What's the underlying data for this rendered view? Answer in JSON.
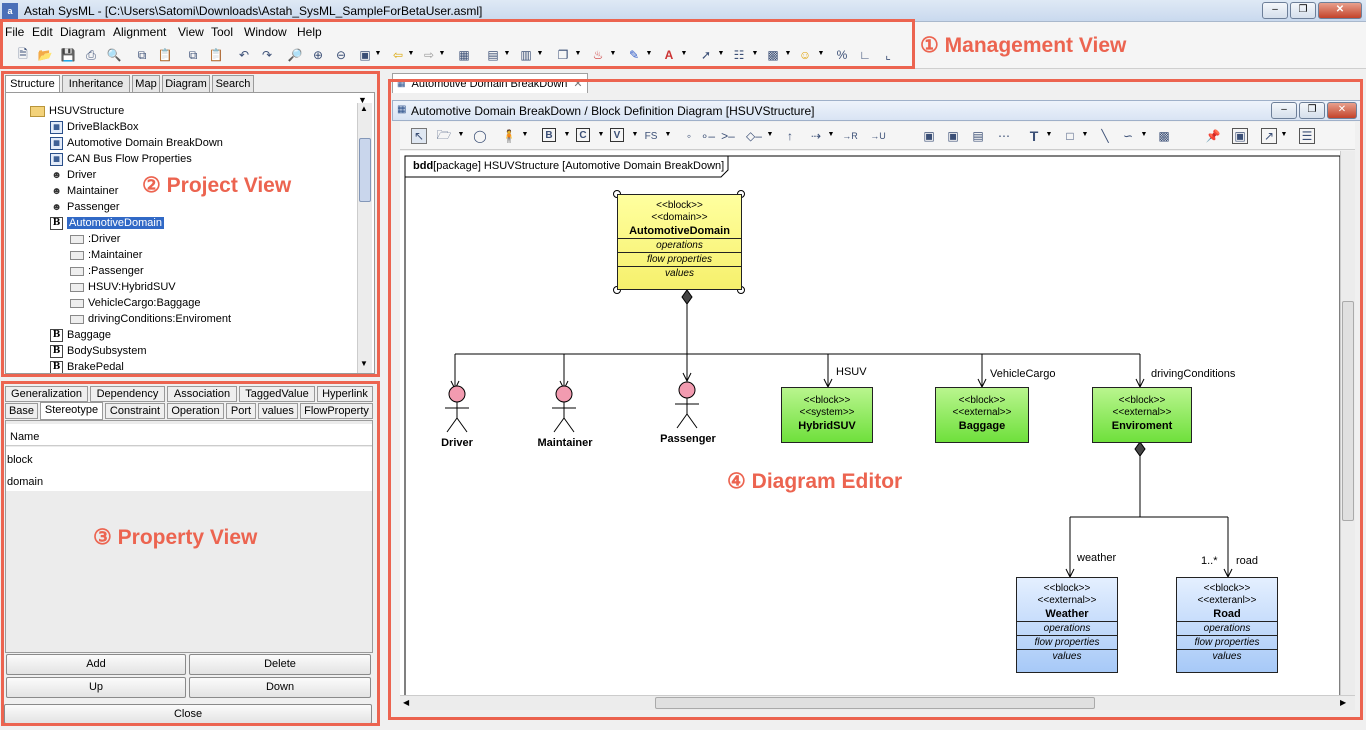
{
  "window": {
    "app_icon": "a",
    "title": "Astah SysML - [C:\\Users\\Satomi\\Downloads\\Astah_SysML_SampleForBetaUser.asml]"
  },
  "menu": [
    "File",
    "Edit",
    "Diagram",
    "Alignment",
    "View",
    "Tool",
    "Window",
    "Help"
  ],
  "callouts": {
    "management": "① Management View",
    "project": "② Project View",
    "property": "③ Property View",
    "editor": "④ Diagram Editor"
  },
  "project_view": {
    "tabs": [
      "Structure",
      "Inheritance",
      "Map",
      "Diagram",
      "Search"
    ],
    "tree": [
      {
        "label": "HSUVStructure",
        "icon": "folder-icon",
        "depth": 0
      },
      {
        "label": "DriveBlackBox",
        "icon": "diagram-icon",
        "depth": 1
      },
      {
        "label": "Automotive Domain BreakDown",
        "icon": "diagram-icon",
        "depth": 1
      },
      {
        "label": "CAN Bus Flow Properties",
        "icon": "diagram-icon",
        "depth": 1
      },
      {
        "label": "Driver",
        "icon": "actor-icon",
        "depth": 1
      },
      {
        "label": "Maintainer",
        "icon": "actor-icon",
        "depth": 1
      },
      {
        "label": "Passenger",
        "icon": "actor-icon",
        "depth": 1
      },
      {
        "label": "AutomotiveDomain",
        "icon": "block-icon",
        "depth": 1,
        "selected": true
      },
      {
        "label": ":Driver",
        "icon": "part-icon",
        "depth": 2
      },
      {
        "label": ":Maintainer",
        "icon": "part-icon",
        "depth": 2
      },
      {
        "label": ":Passenger",
        "icon": "part-icon",
        "depth": 2
      },
      {
        "label": "HSUV:HybridSUV",
        "icon": "part-icon",
        "depth": 2
      },
      {
        "label": "VehicleCargo:Baggage",
        "icon": "part-icon",
        "depth": 2
      },
      {
        "label": "drivingConditions:Enviroment",
        "icon": "part-icon",
        "depth": 2
      },
      {
        "label": "Baggage",
        "icon": "block-icon",
        "depth": 1
      },
      {
        "label": "BodySubsystem",
        "icon": "block-icon",
        "depth": 1
      },
      {
        "label": "BrakePedal",
        "icon": "block-icon",
        "depth": 1
      }
    ]
  },
  "property_view": {
    "tabs_row1": [
      "Generalization",
      "Dependency",
      "Association",
      "TaggedValue",
      "Hyperlink"
    ],
    "tabs_row2": [
      "Base",
      "Stereotype",
      "Constraint",
      "Operation",
      "Port",
      "values",
      "FlowProperty"
    ],
    "selected_tab": "Stereotype",
    "column_header": "Name",
    "rows": [
      "block",
      "domain"
    ],
    "buttons": {
      "add": "Add",
      "delete": "Delete",
      "up": "Up",
      "down": "Down",
      "close": "Close"
    }
  },
  "editor": {
    "tab_label": "Automotive Domain BreakDown",
    "window_title": "Automotive Domain BreakDown / Block Definition Diagram [HSUVStructure]",
    "frame_kind": "bdd",
    "frame_rest": "[package] HSUVStructure [Automotive Domain BreakDown]",
    "compartments": {
      "ops": "operations",
      "flow": "flow properties",
      "values": "values"
    },
    "blocks": {
      "automotive": {
        "stereo1": "<<block>>",
        "stereo2": "<<domain>>",
        "name": "AutomotiveDomain"
      },
      "hybridsuv": {
        "stereo1": "<<block>>",
        "stereo2": "<<system>>",
        "name": "HybridSUV"
      },
      "baggage": {
        "stereo1": "<<block>>",
        "stereo2": "<<external>>",
        "name": "Baggage"
      },
      "enviroment": {
        "stereo1": "<<block>>",
        "stereo2": "<<external>>",
        "name": "Enviroment"
      },
      "weather": {
        "stereo1": "<<block>>",
        "stereo2": "<<external>>",
        "name": "Weather"
      },
      "road": {
        "stereo1": "<<block>>",
        "stereo2": "<<exteranl>>",
        "name": "Road"
      }
    },
    "actors": [
      "Driver",
      "Maintainer",
      "Passenger"
    ],
    "roles": {
      "hsuv": "HSUV",
      "cargo": "VehicleCargo",
      "conditions": "drivingConditions",
      "weather": "weather",
      "road": "road",
      "road_mult": "1..*"
    },
    "colors": {
      "domain_block": "#f7f07a",
      "system_block": "#7ee34a",
      "external_block": "#b5d2f8",
      "actor_head": "#f29bb0",
      "callout": "#ec6450"
    }
  }
}
